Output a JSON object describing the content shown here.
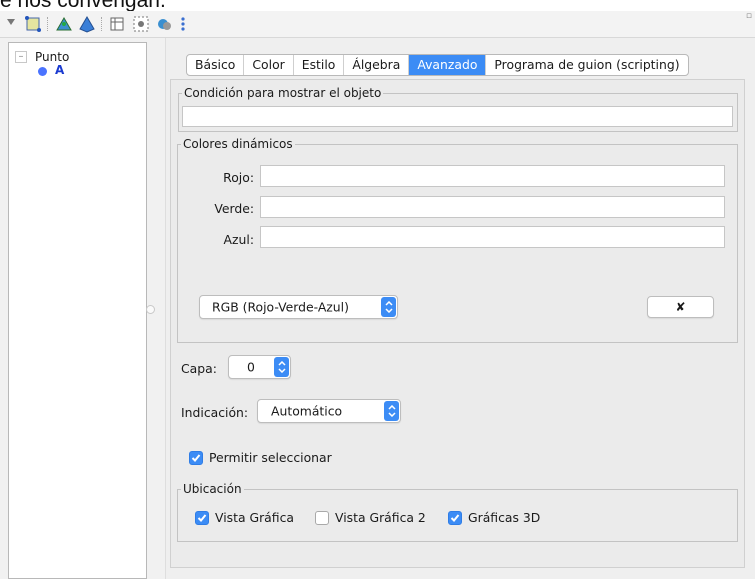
{
  "page_heading_fragment": "e nos convengan.",
  "toolbar": {
    "icons": [
      "move-tool-icon",
      "polygon-tool-icon",
      "pyramid-tool-icon",
      "table-view-icon",
      "point-capture-icon",
      "style-tool-icon",
      "more-options-icon"
    ]
  },
  "tree": {
    "group_label": "Punto",
    "items": [
      {
        "label": "A",
        "color": "#4a73ff"
      }
    ]
  },
  "tabs": [
    {
      "label": "Básico",
      "active": false
    },
    {
      "label": "Color",
      "active": false
    },
    {
      "label": "Estilo",
      "active": false
    },
    {
      "label": "Álgebra",
      "active": false
    },
    {
      "label": "Avanzado",
      "active": true
    },
    {
      "label": "Programa de guion (scripting)",
      "active": false
    }
  ],
  "condition": {
    "legend": "Condición para mostrar el objeto",
    "value": ""
  },
  "dynamic_colors": {
    "legend": "Colores dinámicos",
    "red_label": "Rojo:",
    "red_value": "",
    "green_label": "Verde:",
    "green_value": "",
    "blue_label": "Azul:",
    "blue_value": "",
    "mode_value": "RGB (Rojo-Verde-Azul)",
    "clear_label": "✘"
  },
  "layer": {
    "label": "Capa:",
    "value": "0"
  },
  "tooltip": {
    "label": "Indicación:",
    "value": "Automático"
  },
  "selection": {
    "label": "Permitir seleccionar",
    "checked": true
  },
  "location": {
    "legend": "Ubicación",
    "options": [
      {
        "label": "Vista Gráfica",
        "checked": true
      },
      {
        "label": "Vista Gráfica 2",
        "checked": false
      },
      {
        "label": "Gráficas 3D",
        "checked": true
      }
    ]
  },
  "colors": {
    "accent": "#3c8cf5",
    "point": "#4a73ff"
  }
}
